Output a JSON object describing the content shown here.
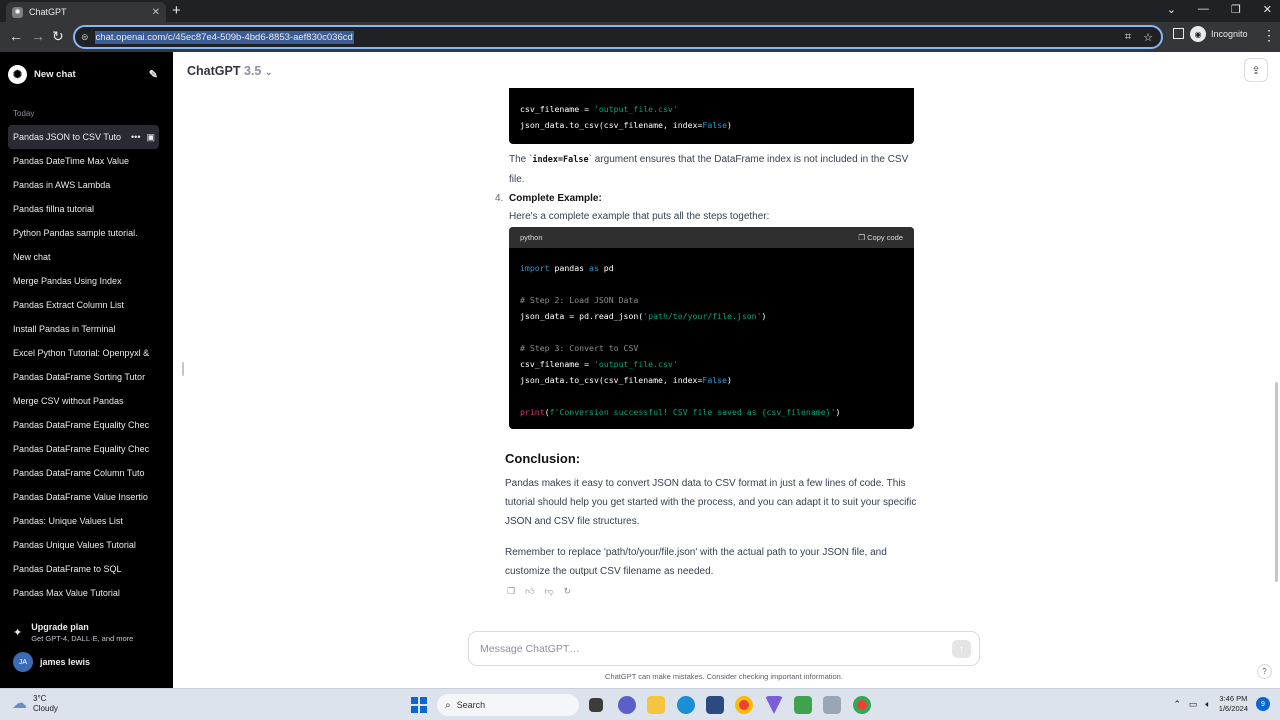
{
  "browser": {
    "tab_title": "ChatGPT",
    "url": "chat.openai.com/c/45ec87e4-509b-4bd6-8853-aef830c036cd",
    "incognito_label": "Incognito"
  },
  "sidebar": {
    "new_chat_label": "New chat",
    "section_today": "Today",
    "items": [
      "Pandas JSON to CSV Tuto",
      "Pandas DateTime Max Value",
      "Pandas in AWS Lambda",
      "Pandas fillna tutorial",
      "Python Pandas sample tutorial.",
      "New chat",
      "Merge Pandas Using Index",
      "Pandas Extract Column List",
      "Install Pandas in Terminal",
      "Excel Python Tutorial: Openpyxl &",
      "Pandas DataFrame Sorting Tutor",
      "Merge CSV without Pandas",
      "Pandas DataFrame Equality Chec",
      "Pandas DataFrame Equality Chec",
      "Pandas DataFrame Column Tuto",
      "Pandas DataFrame Value Insertio",
      "Pandas: Unique Values List",
      "Pandas Unique Values Tutorial",
      "Pandas DataFrame to SQL",
      "Pandas Max Value Tutorial"
    ],
    "upgrade_title": "Upgrade plan",
    "upgrade_sub": "Get GPT-4, DALL·E, and more",
    "user_initials": "JA",
    "user_name": "james lewis"
  },
  "header": {
    "model_name": "ChatGPT",
    "model_version": "3.5"
  },
  "content": {
    "code1": {
      "line1_a": "csv_filename = ",
      "line1_str": "'output_file.csv'",
      "line2_a": "json_data.to_csv(csv_filename, index=",
      "line2_kw": "False",
      "line2_b": ")"
    },
    "para1_a": "The `",
    "para1_code": "index=False",
    "para1_b": "` argument ensures that the DataFrame index is not included in the CSV file.",
    "list_num": "4.",
    "list_title": "Complete Example:",
    "list_sub": "Here's a complete example that puts all the steps together:",
    "code2": {
      "lang": "python",
      "copy_label": "Copy code",
      "l1_kw": "import",
      "l1_a": " pandas ",
      "l1_kw2": "as",
      "l1_b": " pd",
      "l2_cm": "# Step 2: Load JSON Data",
      "l3_a": "json_data = pd.read_json(",
      "l3_str": "'path/to/your/file.json'",
      "l3_b": ")",
      "l4_cm": "# Step 3: Convert to CSV",
      "l5_a": "csv_filename = ",
      "l5_str": "'output_file.csv'",
      "l6_a": "json_data.to_csv(csv_filename, index=",
      "l6_kw": "False",
      "l6_b": ")",
      "l7_fn": "print",
      "l7_a": "(",
      "l7_str": "f'Conversion successful! CSV file saved as {csv_filename}'",
      "l7_b": ")"
    },
    "conclusion_heading": "Conclusion:",
    "para2": "Pandas makes it easy to convert JSON data to CSV format in just a few lines of code. This tutorial should help you get started with the process, and you can adapt it to suit your specific JSON and CSV file structures.",
    "para3": "Remember to replace 'path/to/your/file.json' with the actual path to your JSON file, and customize the output CSV filename as needed."
  },
  "composer": {
    "placeholder": "Message ChatGPT…",
    "disclaimer": "ChatGPT can make mistakes. Consider checking important information.",
    "help": "?"
  },
  "taskbar": {
    "temp": "3°C",
    "weather": "Cloudy",
    "search_label": "Search",
    "time": "3:46 PM",
    "date": "1/6/2024",
    "notifications": "9"
  }
}
